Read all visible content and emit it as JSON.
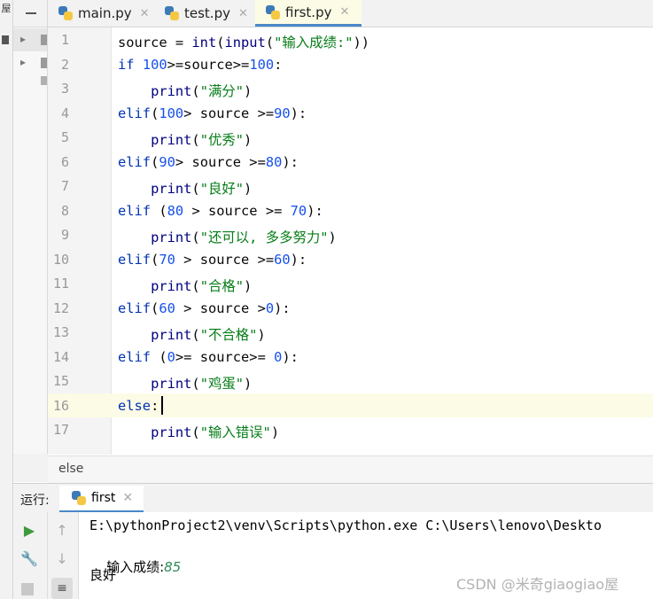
{
  "strip": {
    "glyph": "屋"
  },
  "tabs": [
    {
      "label": "main.py",
      "active": false
    },
    {
      "label": "test.py",
      "active": false
    },
    {
      "label": "first.py",
      "active": true
    }
  ],
  "editor": {
    "lines": [
      {
        "n": "1",
        "text": "source = int(input(\"输入成绩:\"))"
      },
      {
        "n": "2",
        "text": "if 100>=source>=100:"
      },
      {
        "n": "3",
        "text": "    print(\"满分\")"
      },
      {
        "n": "4",
        "text": "elif(100> source >=90):"
      },
      {
        "n": "5",
        "text": "    print(\"优秀\")"
      },
      {
        "n": "6",
        "text": "elif(90> source >=80):"
      },
      {
        "n": "7",
        "text": "    print(\"良好\")"
      },
      {
        "n": "8",
        "text": "elif (80 > source >= 70):"
      },
      {
        "n": "9",
        "text": "    print(\"还可以, 多多努力\")"
      },
      {
        "n": "10",
        "text": "elif(70 > source >=60):"
      },
      {
        "n": "11",
        "text": "    print(\"合格\")"
      },
      {
        "n": "12",
        "text": "elif(60 > source >0):"
      },
      {
        "n": "13",
        "text": "    print(\"不合格\")"
      },
      {
        "n": "14",
        "text": "elif (0>= source>= 0):"
      },
      {
        "n": "15",
        "text": "    print(\"鸡蛋\")"
      },
      {
        "n": "16",
        "text": "else:"
      },
      {
        "n": "17",
        "text": "    print(\"输入错误\")"
      }
    ],
    "current_line": "16"
  },
  "breadcrumb": "else",
  "run": {
    "label": "运行:",
    "tab": "first",
    "console": {
      "command": "E:\\pythonProject2\\venv\\Scripts\\python.exe C:\\Users\\lenovo\\Deskto",
      "prompt": "输入成绩:",
      "input_value": "85",
      "output": "良好"
    }
  },
  "watermark": "CSDN @米奇giaogiao屋",
  "colors": {
    "keyword": "#0033b3",
    "string": "#067d17",
    "number": "#1750eb",
    "input_green": "#2e8b57",
    "tab_accent": "#4a88c7"
  }
}
